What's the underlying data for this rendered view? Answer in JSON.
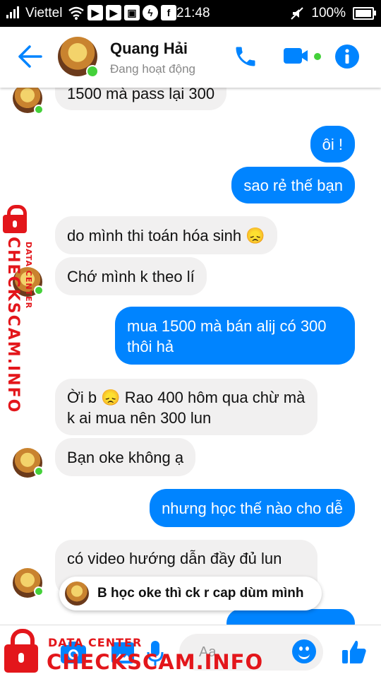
{
  "status_bar": {
    "carrier": "Viettel",
    "time": "21:48",
    "battery": "100%"
  },
  "header": {
    "contact_name": "Quang Hải",
    "contact_status": "Đang hoạt động"
  },
  "messages": [
    {
      "dir": "in",
      "text": "1500 mà pass lại 300"
    },
    {
      "dir": "out",
      "text": "ôi !"
    },
    {
      "dir": "out",
      "text": "sao rẻ thế bạn"
    },
    {
      "dir": "in",
      "text": "do mình thi toán hóa sinh 😞"
    },
    {
      "dir": "in",
      "text": "Chớ mình k theo lí"
    },
    {
      "dir": "out",
      "text": "mua 1500 mà bán alij có 300 thôi hả"
    },
    {
      "dir": "in",
      "text": "Ời b 😞 Rao 400 hôm qua chừ mà k ai mua nên 300 lun"
    },
    {
      "dir": "in",
      "text": "Bạn oke không ạ"
    },
    {
      "dir": "out",
      "text": "nhưng học thế nào cho dễ"
    },
    {
      "dir": "in",
      "text": "có video hướng dẫn đầy đủ lun"
    }
  ],
  "reply_preview": {
    "text": "B học oke thì ck r cap dùm mình"
  },
  "composer": {
    "placeholder": "Aa"
  },
  "watermark": {
    "small": "DATA CENTER",
    "large": "CHECKSCAM.INFO"
  },
  "colors": {
    "messenger_blue": "#0084ff",
    "incoming_bubble": "#f1f0f0",
    "watermark_red": "#e3161b"
  }
}
